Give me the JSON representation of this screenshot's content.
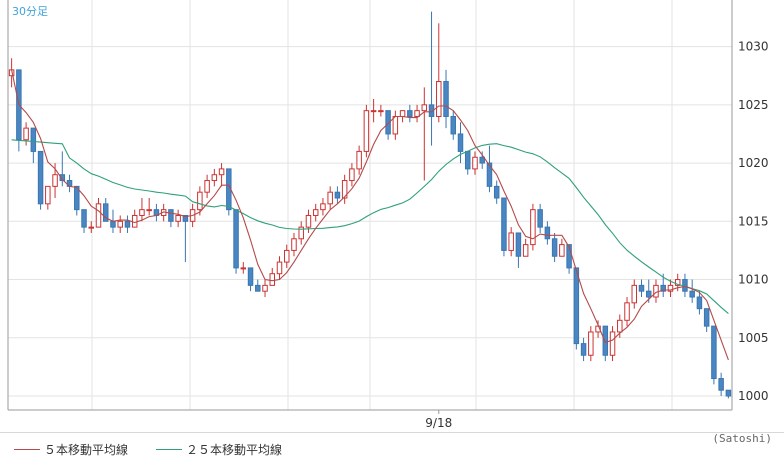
{
  "chart_data": {
    "type": "candlestick",
    "timeframe_label": "30分足",
    "x_tick_labels": [
      {
        "index": 59,
        "label": "9/18"
      }
    ],
    "y_ticks": [
      1000,
      1005,
      1010,
      1015,
      1020,
      1025,
      1030
    ],
    "ylim": [
      998.8,
      1034
    ],
    "grid": true,
    "colors": {
      "up": "#ffffff",
      "up_border": "#cc3333",
      "down": "#4a86c2",
      "down_border": "#3a76b2",
      "ma5": "#b54a4a",
      "ma25": "#2fa07a",
      "grid": "#e3e3e3",
      "axis": "#9a9a9a"
    },
    "candles": [
      [
        1027.5,
        1029,
        1026.5,
        1028
      ],
      [
        1028,
        1028,
        1021,
        1022
      ],
      [
        1022,
        1023.5,
        1021.5,
        1023
      ],
      [
        1023,
        1023,
        1020,
        1021
      ],
      [
        1021,
        1021,
        1016,
        1016.5
      ],
      [
        1016.5,
        1018,
        1016,
        1018
      ],
      [
        1018,
        1020,
        1017,
        1019
      ],
      [
        1019,
        1021,
        1018,
        1018.5
      ],
      [
        1018.5,
        1019,
        1017.5,
        1018
      ],
      [
        1018,
        1018,
        1015.5,
        1016
      ],
      [
        1016,
        1016,
        1014,
        1014.5
      ],
      [
        1014.5,
        1015,
        1014,
        1014.5
      ],
      [
        1014.5,
        1017,
        1014.5,
        1016.5
      ],
      [
        1016.5,
        1017,
        1015,
        1015
      ],
      [
        1015,
        1016,
        1014,
        1014.5
      ],
      [
        1014.5,
        1015.5,
        1014,
        1015
      ],
      [
        1015,
        1015.5,
        1014,
        1014.5
      ],
      [
        1014.5,
        1016,
        1014.5,
        1015.5
      ],
      [
        1015.5,
        1017,
        1015,
        1016
      ],
      [
        1016,
        1017,
        1015.5,
        1016
      ],
      [
        1016,
        1016.5,
        1015,
        1015.5
      ],
      [
        1015.5,
        1016.5,
        1015,
        1016
      ],
      [
        1016,
        1016,
        1014.5,
        1015
      ],
      [
        1015,
        1016,
        1014.5,
        1015.5
      ],
      [
        1015.5,
        1015.5,
        1011.5,
        1015
      ],
      [
        1015,
        1016.5,
        1014.5,
        1016
      ],
      [
        1016,
        1018,
        1015.5,
        1017.5
      ],
      [
        1017.5,
        1019,
        1017,
        1018.5
      ],
      [
        1018.5,
        1019.5,
        1018,
        1019
      ],
      [
        1019,
        1020,
        1018,
        1019.5
      ],
      [
        1019.5,
        1019.5,
        1015.5,
        1016
      ],
      [
        1016,
        1016,
        1010.5,
        1011
      ],
      [
        1011,
        1011.5,
        1010.5,
        1011
      ],
      [
        1011,
        1011,
        1009,
        1009.5
      ],
      [
        1009.5,
        1010,
        1009,
        1009
      ],
      [
        1009,
        1010,
        1008.5,
        1009.5
      ],
      [
        1009.5,
        1011,
        1009.5,
        1010.5
      ],
      [
        1010.5,
        1012,
        1010,
        1011.5
      ],
      [
        1011.5,
        1013,
        1011,
        1012.5
      ],
      [
        1012.5,
        1014,
        1012,
        1013.5
      ],
      [
        1013.5,
        1015,
        1013,
        1014.5
      ],
      [
        1014.5,
        1016,
        1014,
        1015.5
      ],
      [
        1015.5,
        1016.5,
        1015,
        1016
      ],
      [
        1016,
        1017,
        1015.5,
        1016.5
      ],
      [
        1016.5,
        1018,
        1016,
        1017.5
      ],
      [
        1017.5,
        1018,
        1016.5,
        1017
      ],
      [
        1017,
        1019,
        1016.5,
        1018.5
      ],
      [
        1018.5,
        1020,
        1018,
        1019.5
      ],
      [
        1019.5,
        1021.5,
        1019,
        1021
      ],
      [
        1021,
        1025,
        1020.5,
        1024.5
      ],
      [
        1024.5,
        1025.5,
        1023.5,
        1024.5
      ],
      [
        1024.5,
        1025,
        1024,
        1024.5
      ],
      [
        1024.5,
        1024.5,
        1022,
        1022.5
      ],
      [
        1022.5,
        1024.5,
        1022,
        1024
      ],
      [
        1024,
        1024.5,
        1023.5,
        1024.5
      ],
      [
        1024.5,
        1025,
        1023.5,
        1024
      ],
      [
        1024,
        1025,
        1023.5,
        1024.5
      ],
      [
        1024.5,
        1026.5,
        1018.5,
        1025
      ],
      [
        1025,
        1033,
        1021.5,
        1024
      ],
      [
        1024,
        1032,
        1023.5,
        1027
      ],
      [
        1027,
        1028,
        1023,
        1024
      ],
      [
        1024,
        1024.5,
        1022,
        1022.5
      ],
      [
        1022.5,
        1023.5,
        1020,
        1021
      ],
      [
        1021,
        1021,
        1019,
        1019.5
      ],
      [
        1019.5,
        1021,
        1019,
        1020.5
      ],
      [
        1020.5,
        1021,
        1019.5,
        1020
      ],
      [
        1020,
        1021.5,
        1017.5,
        1018
      ],
      [
        1018,
        1018.5,
        1016.5,
        1017
      ],
      [
        1017,
        1017,
        1012,
        1012.5
      ],
      [
        1012.5,
        1014.5,
        1012,
        1014
      ],
      [
        1014,
        1014,
        1011,
        1012
      ],
      [
        1012,
        1013.5,
        1012,
        1013
      ],
      [
        1013,
        1016.5,
        1012.5,
        1016
      ],
      [
        1016,
        1016.5,
        1014,
        1014.5
      ],
      [
        1014.5,
        1015,
        1013,
        1013.5
      ],
      [
        1013.5,
        1014,
        1011.5,
        1012
      ],
      [
        1012,
        1013.5,
        1012,
        1013
      ],
      [
        1013,
        1013,
        1010.5,
        1011
      ],
      [
        1011,
        1011,
        1004,
        1004.5
      ],
      [
        1004.5,
        1005,
        1003,
        1003.5
      ],
      [
        1003.5,
        1006,
        1003,
        1005.5
      ],
      [
        1005.5,
        1006.5,
        1005,
        1006
      ],
      [
        1006,
        1006,
        1003,
        1003.5
      ],
      [
        1003.5,
        1006,
        1003,
        1005.5
      ],
      [
        1005.5,
        1007,
        1005,
        1006.5
      ],
      [
        1006.5,
        1008.5,
        1006,
        1008
      ],
      [
        1008,
        1010,
        1007.5,
        1009.5
      ],
      [
        1009.5,
        1010,
        1008.5,
        1009
      ],
      [
        1009,
        1010,
        1008,
        1008.5
      ],
      [
        1008.5,
        1010,
        1008,
        1009.5
      ],
      [
        1009.5,
        1010.5,
        1008.5,
        1009
      ],
      [
        1009,
        1010,
        1008.5,
        1009.5
      ],
      [
        1009.5,
        1010.5,
        1009,
        1010
      ],
      [
        1010,
        1010.5,
        1008.5,
        1009
      ],
      [
        1009,
        1010,
        1008,
        1008.5
      ],
      [
        1008.5,
        1009,
        1007,
        1007.5
      ],
      [
        1007.5,
        1007.5,
        1005.5,
        1006
      ],
      [
        1006,
        1006,
        1001,
        1001.5
      ],
      [
        1001.5,
        1002,
        1000,
        1000.5
      ],
      [
        1000.5,
        1000.5,
        999.8,
        1000
      ]
    ],
    "series": [
      {
        "name": "５本移動平均線",
        "values": []
      },
      {
        "name": "２５本移動平均線",
        "values": []
      }
    ],
    "credit": "(Satoshi)"
  }
}
